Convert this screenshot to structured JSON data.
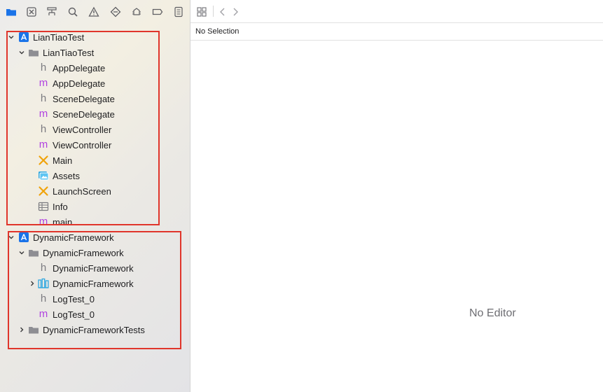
{
  "navigator": {
    "toolbar_icons": [
      "project-navigator-icon",
      "source-control-icon",
      "symbol-navigator-icon",
      "find-icon",
      "issue-icon",
      "test-icon",
      "debug-icon",
      "breakpoint-icon",
      "report-icon"
    ],
    "projects": [
      {
        "name": "LianTiaoTest",
        "group": "LianTiaoTest",
        "files": [
          {
            "name": "AppDelegate",
            "kind": "h"
          },
          {
            "name": "AppDelegate",
            "kind": "m"
          },
          {
            "name": "SceneDelegate",
            "kind": "h"
          },
          {
            "name": "SceneDelegate",
            "kind": "m"
          },
          {
            "name": "ViewController",
            "kind": "h"
          },
          {
            "name": "ViewController",
            "kind": "m"
          },
          {
            "name": "Main",
            "kind": "storyboard"
          },
          {
            "name": "Assets",
            "kind": "assets"
          },
          {
            "name": "LaunchScreen",
            "kind": "storyboard"
          },
          {
            "name": "Info",
            "kind": "plist"
          },
          {
            "name": "main",
            "kind": "m"
          }
        ]
      },
      {
        "name": "DynamicFramework",
        "group": "DynamicFramework",
        "files": [
          {
            "name": "DynamicFramework",
            "kind": "h"
          },
          {
            "name": "DynamicFramework",
            "kind": "framework"
          },
          {
            "name": "LogTest_0",
            "kind": "h"
          },
          {
            "name": "LogTest_0",
            "kind": "m"
          }
        ],
        "tests_group": "DynamicFrameworkTests"
      }
    ]
  },
  "editor": {
    "jump_bar_text": "No Selection",
    "placeholder": "No Editor"
  },
  "colors": {
    "accent": "#1a73e8",
    "header_m": "#b041e0",
    "storyboard": "#f0a30a",
    "highlight_box": "#e0352b"
  }
}
